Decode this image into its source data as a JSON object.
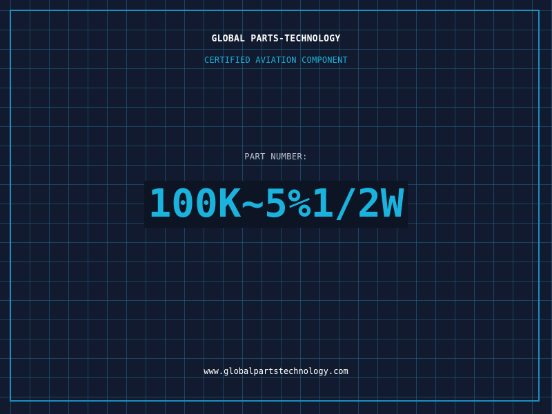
{
  "header": {
    "company": "GLOBAL PARTS-TECHNOLOGY",
    "subtitle": "CERTIFIED AVIATION COMPONENT"
  },
  "part": {
    "label": "PART NUMBER:",
    "number": "100K~5%1/2W"
  },
  "footer": {
    "url": "www.globalpartstechnology.com"
  },
  "colors": {
    "background": "#111a2e",
    "accent": "#1ab3dd",
    "frame": "#1b8fbf",
    "label": "#b8c4d4",
    "text": "#ffffff"
  }
}
